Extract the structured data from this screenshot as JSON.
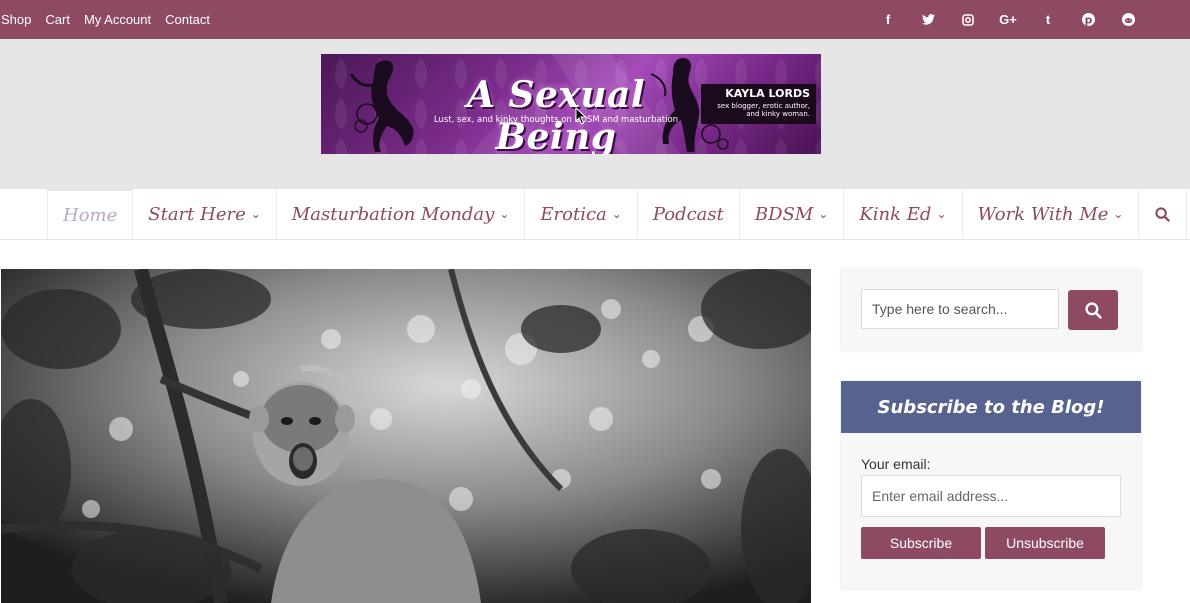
{
  "topbar": {
    "links": [
      "Shop",
      "Cart",
      "My Account",
      "Contact"
    ],
    "social_icons": [
      "facebook-icon",
      "twitter-icon",
      "instagram-icon",
      "google-plus-icon",
      "tumblr-icon",
      "pinterest-icon",
      "reddit-icon"
    ],
    "social_glyphs": [
      "f",
      "t",
      "◙",
      "G+",
      "t",
      "p",
      "r"
    ],
    "background": "#8e4a63"
  },
  "banner": {
    "title": "A Sexual Being",
    "tagline": "Lust, sex, and kinky thoughts on BDSM and masturbation",
    "author": "KAYLA LORDS",
    "author_desc": "sex blogger, erotic author, and kinky woman."
  },
  "nav": {
    "items": [
      {
        "label": "Home",
        "dropdown": false,
        "active": true
      },
      {
        "label": "Start Here",
        "dropdown": true
      },
      {
        "label": "Masturbation Monday",
        "dropdown": true
      },
      {
        "label": "Erotica",
        "dropdown": true
      },
      {
        "label": "Podcast",
        "dropdown": false
      },
      {
        "label": "BDSM",
        "dropdown": true
      },
      {
        "label": "Kink Ed",
        "dropdown": true
      },
      {
        "label": "Work With Me",
        "dropdown": true
      }
    ],
    "accent": "#8e4a63"
  },
  "sidebar": {
    "search_placeholder": "Type here to search...",
    "subscribe_title": "Subscribe to the Blog!",
    "email_label": "Your email:",
    "email_placeholder": "Enter email address...",
    "subscribe_label": "Subscribe",
    "unsubscribe_label": "Unsubscribe",
    "header_color": "#57628f"
  }
}
